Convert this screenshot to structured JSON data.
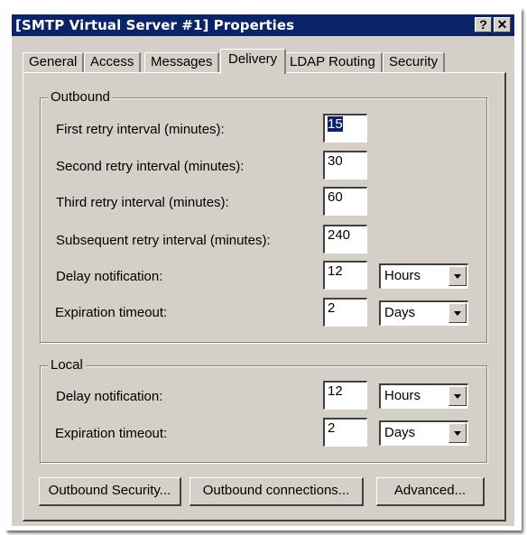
{
  "window": {
    "title": "[SMTP Virtual Server #1] Properties",
    "help_button": "?",
    "close_button": "✕"
  },
  "tabs": [
    {
      "label": "General",
      "active": false
    },
    {
      "label": "Access",
      "active": false
    },
    {
      "label": "Messages",
      "active": false
    },
    {
      "label": "Delivery",
      "active": true
    },
    {
      "label": "LDAP Routing",
      "active": false
    },
    {
      "label": "Security",
      "active": false
    }
  ],
  "outbound": {
    "group_label": "Outbound",
    "first_retry": {
      "label": "First retry interval (minutes):",
      "value": "15"
    },
    "second_retry": {
      "label": "Second retry interval (minutes):",
      "value": "30"
    },
    "third_retry": {
      "label": "Third retry interval (minutes):",
      "value": "60"
    },
    "subsequent_retry": {
      "label": "Subsequent retry interval (minutes):",
      "value": "240"
    },
    "delay_notification": {
      "label": "Delay notification:",
      "value": "12",
      "unit": "Hours"
    },
    "expiration_timeout": {
      "label": "Expiration timeout:",
      "value": "2",
      "unit": "Days"
    }
  },
  "local": {
    "group_label": "Local",
    "delay_notification": {
      "label": "Delay notification:",
      "value": "12",
      "unit": "Hours"
    },
    "expiration_timeout": {
      "label": "Expiration timeout:",
      "value": "2",
      "unit": "Days"
    }
  },
  "buttons": {
    "outbound_security": "Outbound Security...",
    "outbound_connections": "Outbound connections...",
    "advanced": "Advanced..."
  }
}
